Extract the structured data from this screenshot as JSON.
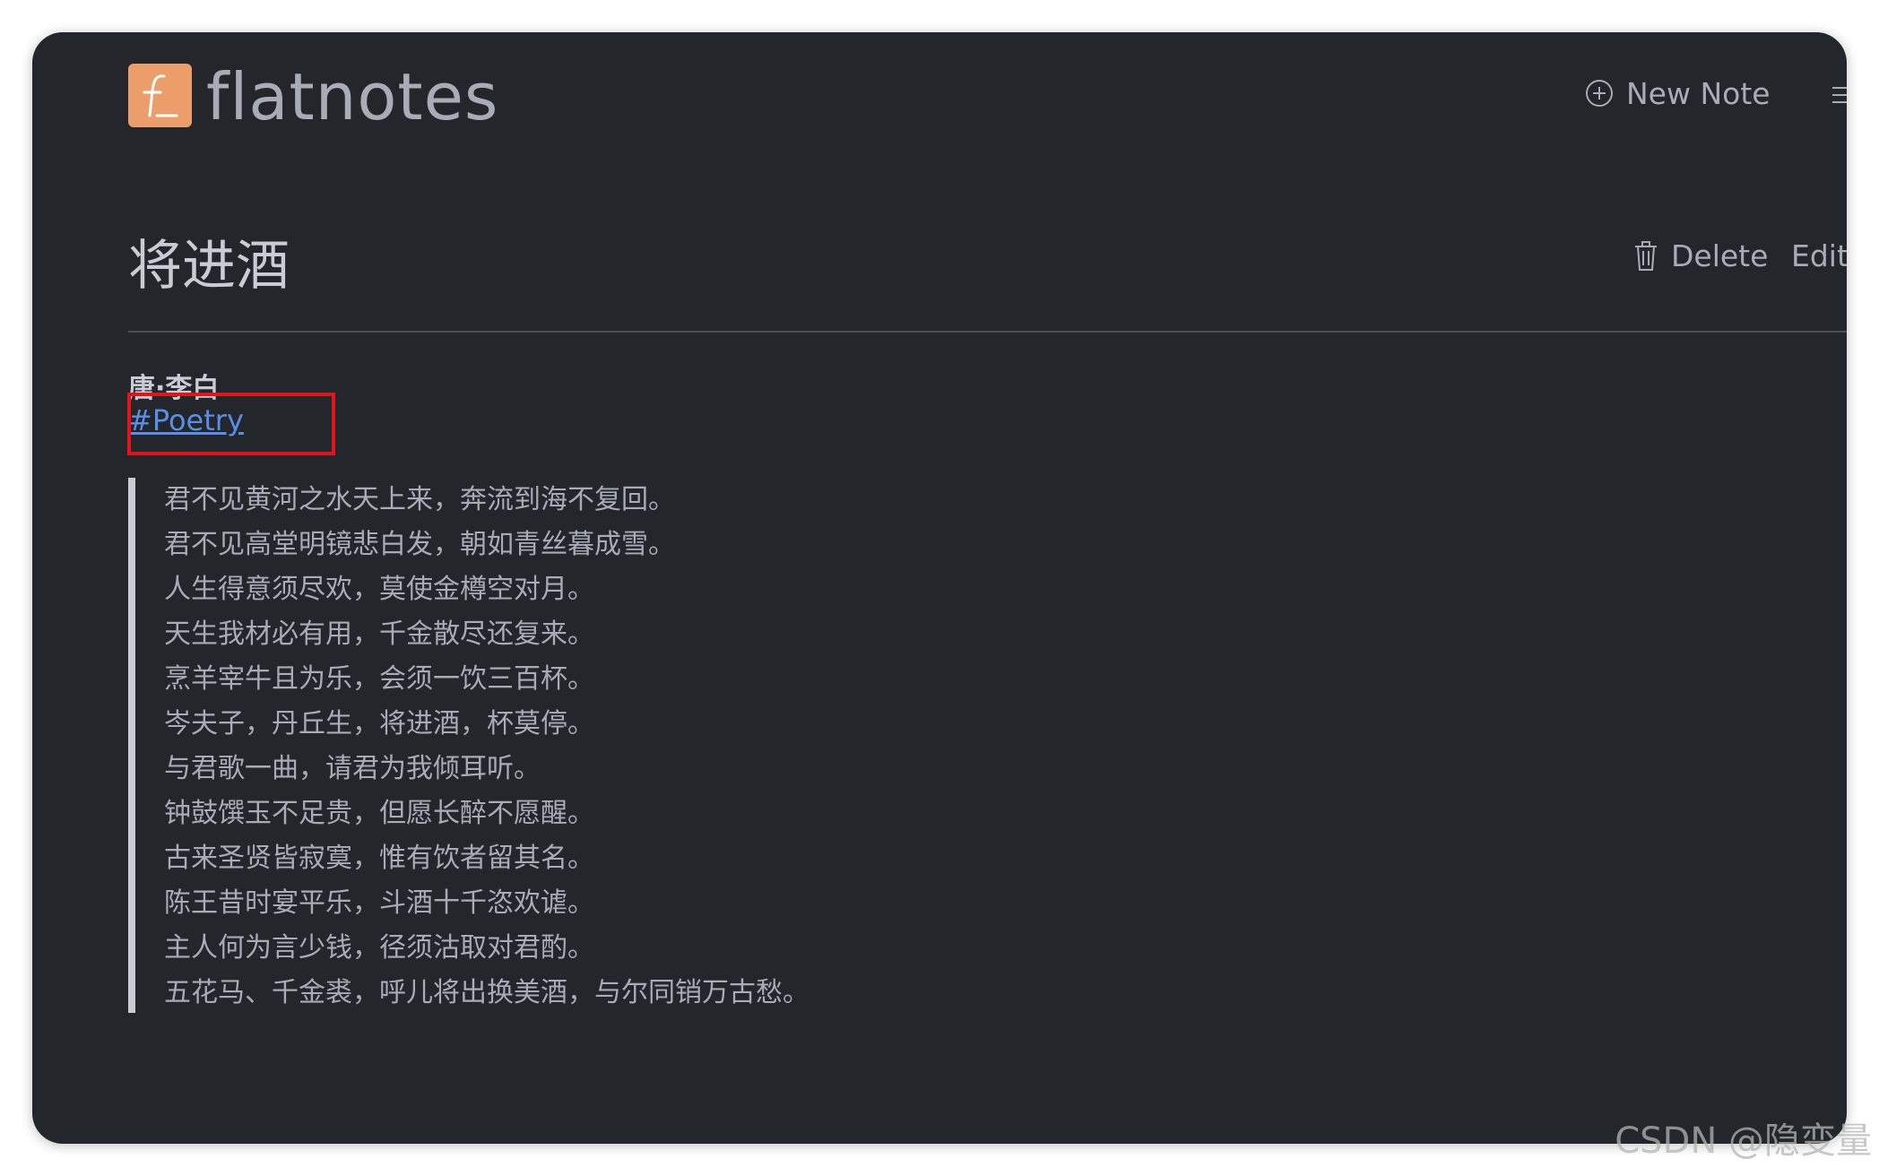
{
  "header": {
    "brand": "flatnotes",
    "logo_letter": "f_",
    "new_note_label": "New Note",
    "menu_label": "M"
  },
  "note": {
    "title": "将进酒",
    "delete_label": "Delete",
    "edit_label": "Edit",
    "author": "唐·李白",
    "tag": "#Poetry",
    "lines": [
      "君不见黄河之水天上来，奔流到海不复回。",
      "君不见高堂明镜悲白发，朝如青丝暮成雪。",
      "人生得意须尽欢，莫使金樽空对月。",
      "天生我材必有用，千金散尽还复来。",
      "烹羊宰牛且为乐，会须一饮三百杯。",
      "岑夫子，丹丘生，将进酒，杯莫停。",
      "与君歌一曲，请君为我倾耳听。",
      "钟鼓馔玉不足贵，但愿长醉不愿醒。",
      "古来圣贤皆寂寞，惟有饮者留其名。",
      "陈王昔时宴平乐，斗酒十千恣欢谑。",
      "主人何为言少钱，径须沽取对君酌。",
      "五花马、千金裘，呼儿将出换美酒，与尔同销万古愁。"
    ]
  },
  "watermark": "CSDN @隐变量",
  "colors": {
    "background": "#23262b",
    "accent_logo": "#ec9e6a",
    "link": "#5b8ee6",
    "highlight_box": "#e0141a",
    "text": "#a7acb5"
  }
}
